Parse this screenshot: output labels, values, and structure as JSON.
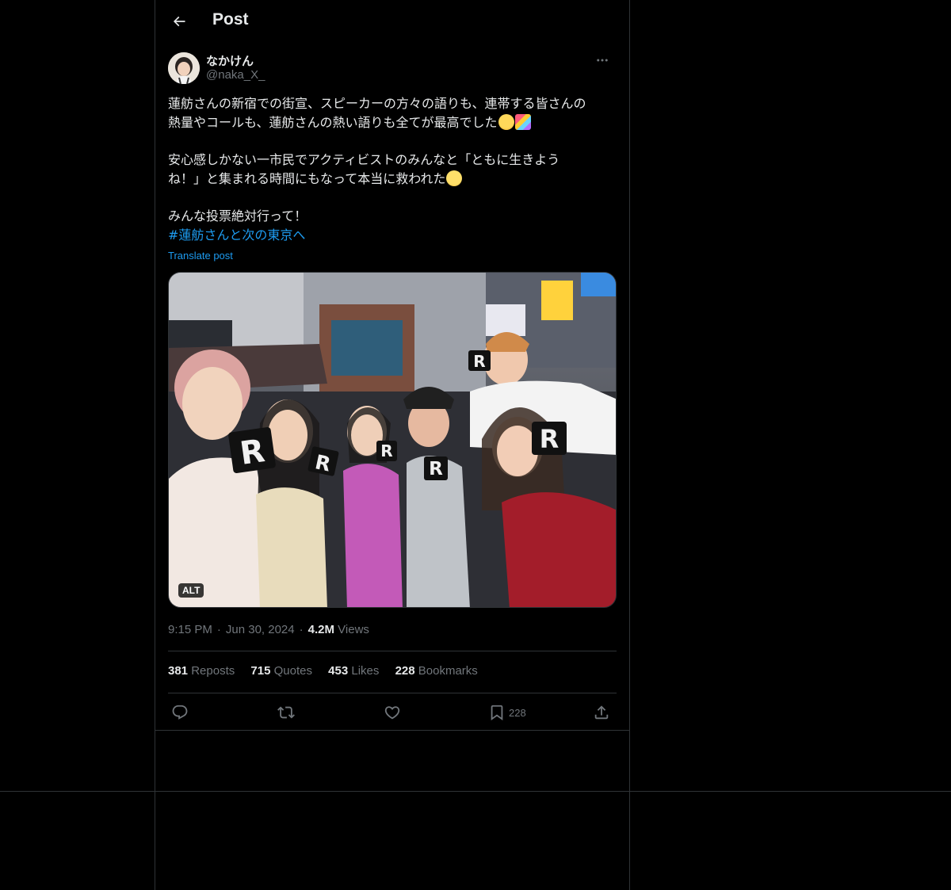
{
  "header": {
    "title": "Post",
    "back_icon": "back-arrow-icon"
  },
  "author": {
    "display_name": "なかけん",
    "handle": "@naka_X_"
  },
  "post": {
    "paragraph1_line1": "蓮舫さんの新宿での街宣、スピーカーの方々の語りも、連帯する皆さんの",
    "paragraph1_line2": "熱量やコールも、蓮舫さんの熱い語りも全てが最高でした",
    "paragraph2_line1": "安心感しかない一市民でアクティビストのみんなと「ともに生きよう",
    "paragraph2_line2": "ね！」と集まれる時間にもなって本当に救われた",
    "paragraph3": "みんな投票絶対行って！",
    "hashtag": "#蓮舫さんと次の東京へ",
    "translate_label": "Translate post",
    "emoji": [
      "crying-face-emoji",
      "party-popper-emoji",
      "holding-back-tears-emoji"
    ]
  },
  "media": {
    "alt_badge": "ALT",
    "sign_letter": "R"
  },
  "meta": {
    "time": "9:15 PM",
    "date": "Jun 30, 2024",
    "views_count": "4.2M",
    "views_label": "Views"
  },
  "stats": {
    "reposts_count": "381",
    "reposts_label": "Reposts",
    "quotes_count": "715",
    "quotes_label": "Quotes",
    "likes_count": "453",
    "likes_label": "Likes",
    "bookmarks_count": "228",
    "bookmarks_label": "Bookmarks"
  },
  "actions": {
    "reply_icon": "reply-icon",
    "repost_icon": "repost-icon",
    "like_icon": "heart-icon",
    "bookmark_icon": "bookmark-icon",
    "bookmark_count": "228",
    "share_icon": "share-icon"
  },
  "colors": {
    "background": "#000000",
    "text": "#e7e9ea",
    "secondary": "#71767b",
    "accent": "#1d9bf0",
    "border": "#2f3336"
  }
}
